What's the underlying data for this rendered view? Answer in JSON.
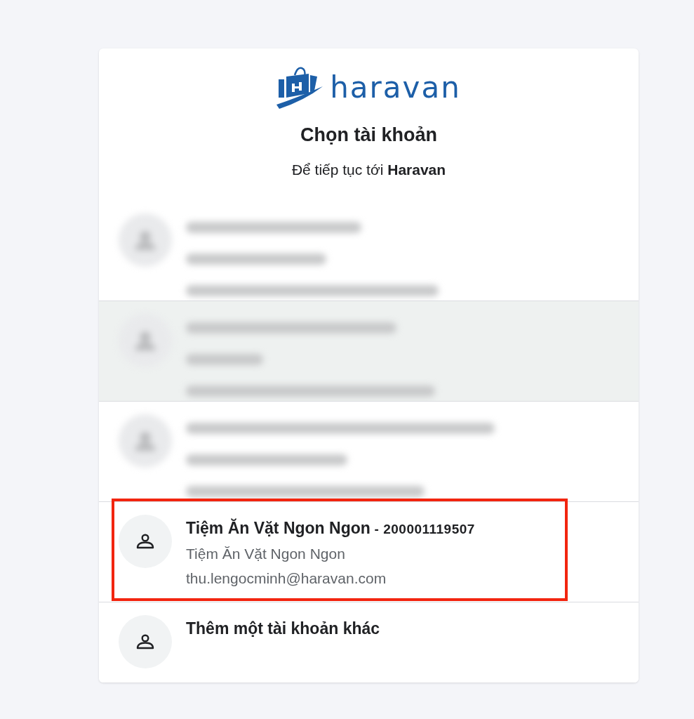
{
  "logo": {
    "wordmark": "haravan"
  },
  "title": "Chọn tài khoản",
  "subtitle": "Để tiếp tục tới **Haravan**",
  "accounts": [
    {
      "kind": "blurred",
      "highlighted": false,
      "annotated": false
    },
    {
      "kind": "blurred",
      "highlighted": true,
      "annotated": false
    },
    {
      "kind": "blurred",
      "highlighted": false,
      "annotated": false
    },
    {
      "kind": "account",
      "highlighted": false,
      "annotated": true,
      "name": "Tiệm Ăn Vặt Ngon Ngon",
      "id": "- 200001119507",
      "shop": "Tiệm Ăn Vặt Ngon Ngon",
      "email": "thu.lengocminh@haravan.com"
    },
    {
      "kind": "add",
      "highlighted": false,
      "annotated": false,
      "label": "Thêm một tài khoản khác"
    }
  ]
}
